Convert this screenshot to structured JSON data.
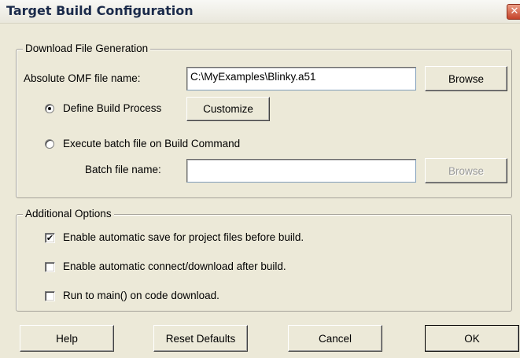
{
  "window": {
    "title": "Target Build Configuration",
    "close_glyph": "✕"
  },
  "download": {
    "legend": "Download File Generation",
    "omf_label": "Absolute OMF file name:",
    "omf_value": "C:\\MyExamples\\Blinky.a51",
    "browse_label": "Browse",
    "define_build_label": "Define Build Process",
    "define_build_selected": true,
    "customize_label": "Customize",
    "execute_batch_label": "Execute batch file on Build Command",
    "execute_batch_selected": false,
    "batch_file_label": "Batch file name:",
    "batch_file_value": "",
    "batch_browse_label": "Browse",
    "batch_browse_enabled": false
  },
  "options": {
    "legend": "Additional Options",
    "auto_save": {
      "label": "Enable automatic save for project files before build.",
      "checked": true,
      "mark": "✔"
    },
    "auto_connect": {
      "label": "Enable automatic connect/download after build.",
      "checked": false
    },
    "run_to_main": {
      "label": "Run to main() on code download.",
      "checked": false
    }
  },
  "footer": {
    "help_label": "Help",
    "reset_label": "Reset Defaults",
    "cancel_label": "Cancel",
    "ok_label": "OK"
  }
}
